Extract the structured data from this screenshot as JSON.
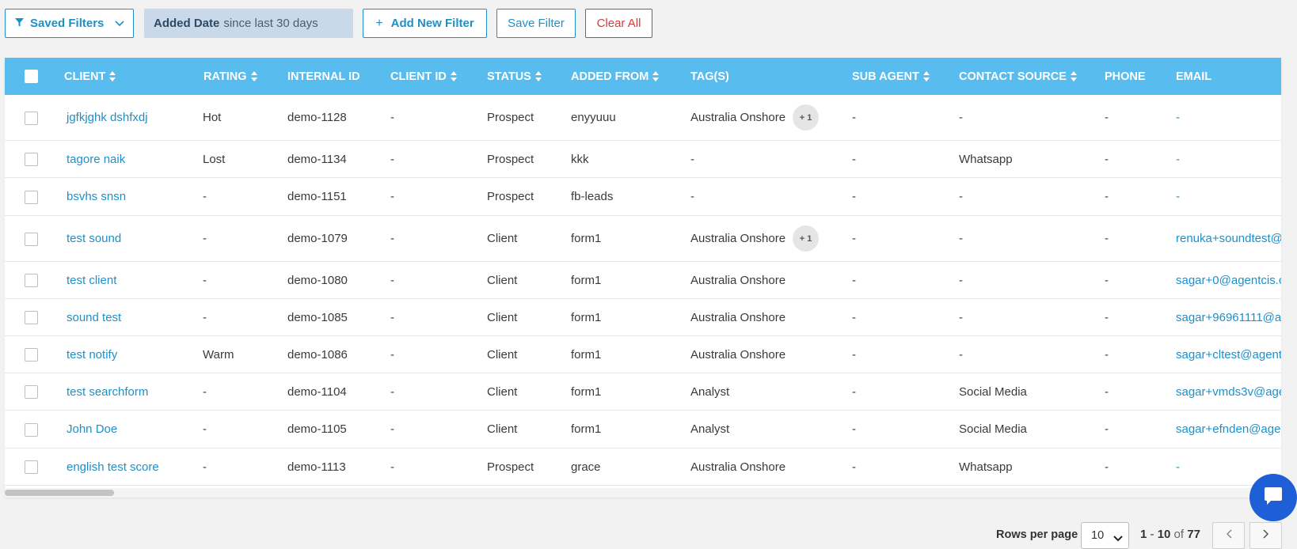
{
  "toolbar": {
    "saved_filters_label": "Saved Filters",
    "date_filter_field": "Added Date",
    "date_filter_value": "since last 30 days",
    "add_filter_label": "Add New Filter",
    "add_filter_plus": "+",
    "save_filter_label": "Save Filter",
    "clear_all_label": "Clear All"
  },
  "table": {
    "headers": [
      "CLIENT",
      "RATING",
      "INTERNAL ID",
      "CLIENT ID",
      "STATUS",
      "ADDED FROM",
      "TAG(S)",
      "SUB AGENT",
      "CONTACT SOURCE",
      "PHONE",
      "EMAIL"
    ],
    "rows": [
      {
        "client": "jgfkjghk dshfxdj",
        "rating": "Hot",
        "internal_id": "demo-1128",
        "client_id": "-",
        "status": "Prospect",
        "added_from": "enyyuuu",
        "tags": "Australia Onshore",
        "tag_extra": "+ 1",
        "sub_agent": "-",
        "contact_source": "-",
        "phone": "-",
        "email": "-"
      },
      {
        "client": "tagore naik",
        "rating": "Lost",
        "internal_id": "demo-1134",
        "client_id": "-",
        "status": "Prospect",
        "added_from": "kkk",
        "tags": "-",
        "tag_extra": "",
        "sub_agent": "-",
        "contact_source": "Whatsapp",
        "phone": "-",
        "email": "-"
      },
      {
        "client": "bsvhs snsn",
        "rating": "-",
        "internal_id": "demo-1151",
        "client_id": "-",
        "status": "Prospect",
        "added_from": "fb-leads",
        "tags": "-",
        "tag_extra": "",
        "sub_agent": "-",
        "contact_source": "-",
        "phone": "-",
        "email": "-"
      },
      {
        "client": "test sound",
        "rating": "-",
        "internal_id": "demo-1079",
        "client_id": "-",
        "status": "Client",
        "added_from": "form1",
        "tags": "Australia Onshore",
        "tag_extra": "+ 1",
        "sub_agent": "-",
        "contact_source": "-",
        "phone": "-",
        "email": "renuka+soundtest@"
      },
      {
        "client": "test client",
        "rating": "-",
        "internal_id": "demo-1080",
        "client_id": "-",
        "status": "Client",
        "added_from": "form1",
        "tags": "Australia Onshore",
        "tag_extra": "",
        "sub_agent": "-",
        "contact_source": "-",
        "phone": "-",
        "email": "sagar+0@agentcis.c"
      },
      {
        "client": "sound test",
        "rating": "-",
        "internal_id": "demo-1085",
        "client_id": "-",
        "status": "Client",
        "added_from": "form1",
        "tags": "Australia Onshore",
        "tag_extra": "",
        "sub_agent": "-",
        "contact_source": "-",
        "phone": "-",
        "email": "sagar+96961111@a"
      },
      {
        "client": "test notify",
        "rating": "Warm",
        "internal_id": "demo-1086",
        "client_id": "-",
        "status": "Client",
        "added_from": "form1",
        "tags": "Australia Onshore",
        "tag_extra": "",
        "sub_agent": "-",
        "contact_source": "-",
        "phone": "-",
        "email": "sagar+cltest@agent"
      },
      {
        "client": "test searchform",
        "rating": "-",
        "internal_id": "demo-1104",
        "client_id": "-",
        "status": "Client",
        "added_from": "form1",
        "tags": "Analyst",
        "tag_extra": "",
        "sub_agent": "-",
        "contact_source": "Social Media",
        "phone": "-",
        "email": "sagar+vmds3v@age"
      },
      {
        "client": "John Doe",
        "rating": "-",
        "internal_id": "demo-1105",
        "client_id": "-",
        "status": "Client",
        "added_from": "form1",
        "tags": "Analyst",
        "tag_extra": "",
        "sub_agent": "-",
        "contact_source": "Social Media",
        "phone": "-",
        "email": "sagar+efnden@age"
      },
      {
        "client": "english test score",
        "rating": "-",
        "internal_id": "demo-1113",
        "client_id": "-",
        "status": "Prospect",
        "added_from": "grace",
        "tags": "Australia Onshore",
        "tag_extra": "",
        "sub_agent": "-",
        "contact_source": "Whatsapp",
        "phone": "-",
        "email": "-"
      }
    ]
  },
  "pagination": {
    "rows_per_page_label": "Rows per page",
    "rows_per_page_value": "10",
    "range_start": "1",
    "range_sep": "-",
    "range_end": "10",
    "of_label": "of",
    "total": "77"
  },
  "colors": {
    "header_bg": "#58bcef",
    "link": "#1e90c8",
    "danger": "#d63a3a",
    "chip_bg": "#c9d9ea",
    "chat": "#1e5fd8"
  },
  "icons": {
    "filter": "filter-icon",
    "chevron": "chevron-down-icon",
    "sort": "sort-icon",
    "chat": "chat-icon",
    "prev": "chevron-left-icon",
    "next": "chevron-right-icon"
  }
}
